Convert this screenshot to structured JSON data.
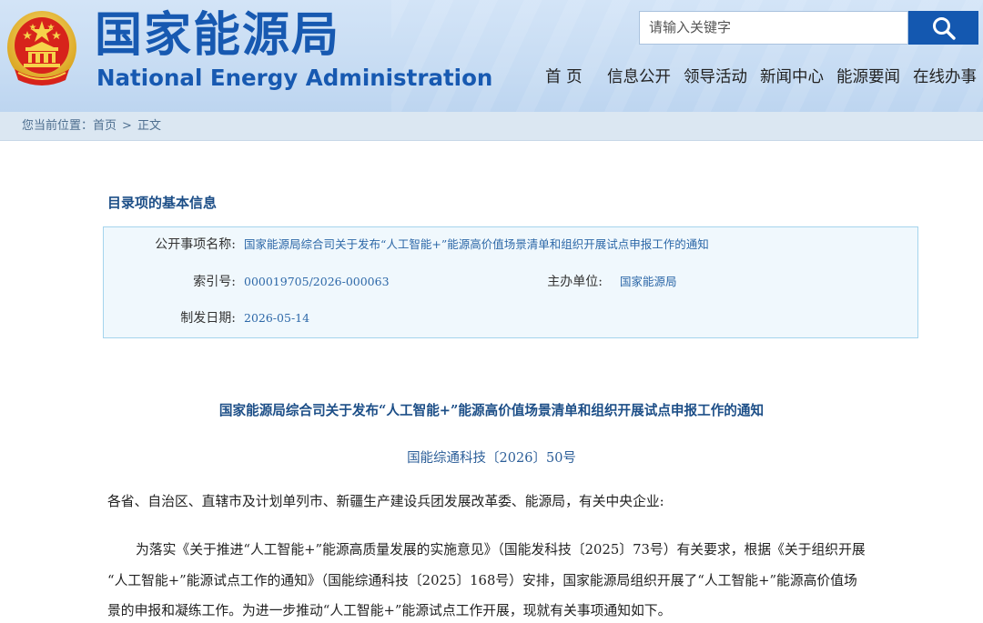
{
  "header": {
    "site_name_cn": "国家能源局",
    "site_name_en": "National Energy Administration",
    "search_placeholder": "请输入关键字"
  },
  "nav": [
    "首 页",
    "信息公开",
    "领导活动",
    "新闻中心",
    "能源要闻",
    "在线办事"
  ],
  "breadcrumb": {
    "prefix": "您当前位置：",
    "home": "首页",
    "separator": ">",
    "current": "正文"
  },
  "info": {
    "section_title": "目录项的基本信息",
    "subject_label": "公开事项名称:",
    "subject_value": "国家能源局综合司关于发布“人工智能+”能源高价值场景清单和组织开展试点申报工作的通知",
    "index_label": "索引号:",
    "index_value": "000019705/2026-000063",
    "org_label": "主办单位:",
    "org_value": "国家能源局",
    "date_label": "制发日期:",
    "date_value": "2026-05-14"
  },
  "document": {
    "title": "国家能源局综合司关于发布“人工智能+”能源高价值场景清单和组织开展试点申报工作的通知",
    "number": "国能综通科技〔2026〕50号",
    "recipients": "各省、自治区、直辖市及计划单列市、新疆生产建设兵团发展改革委、能源局，有关中央企业:",
    "paragraph_lines": [
      "为落实《关于推进“人工智能+”能源高质量发展的实施意见》（国能发科技〔2025〕73号）有关要求，根据《关于组织开展",
      "“人工智能+”能源试点工作的通知》（国能综通科技〔2025〕168号）安排，国家能源局组织开展了“人工智能+”能源高价值场",
      "景的申报和凝练工作。为进一步推动“人工智能+”能源试点工作开展，现就有关事项通知如下。"
    ]
  },
  "colors": {
    "brand_blue": "#1759b1",
    "header_bg": "#c7dcf3",
    "search_button": "#1458b0",
    "info_box_bg": "#f0f8fd",
    "info_box_border": "#a5d4ed",
    "link_blue": "#2d68a8",
    "emblem_red": "#d7231b",
    "emblem_gold": "#f2c230"
  },
  "icons": {
    "search": "search-icon",
    "emblem": "national-emblem-icon"
  }
}
